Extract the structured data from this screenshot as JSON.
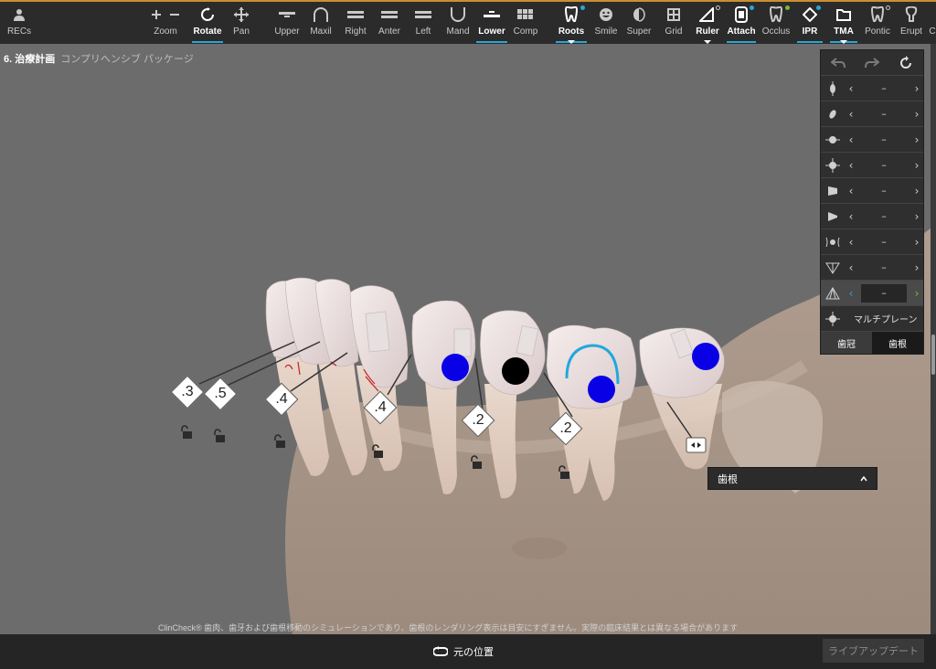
{
  "toolbar": {
    "recs_label": "RECs",
    "zoom_label": "Zoom",
    "rotate_label": "Rotate",
    "pan_label": "Pan",
    "upper_label": "Upper",
    "maxil_label": "Maxil",
    "right_label": "Right",
    "anter_label": "Anter",
    "left_label": "Left",
    "mand_label": "Mand",
    "lower_label": "Lower",
    "comp_label": "Comp",
    "roots_label": "Roots",
    "smile_label": "Smile",
    "super_label": "Super",
    "grid_label": "Grid",
    "ruler_label": "Ruler",
    "attach_label": "Attach",
    "occlus_label": "Occlus",
    "ipr_label": "IPR",
    "tma_label": "TMA",
    "pontic_label": "Pontic",
    "erupt_label": "Erupt",
    "overflow_label": "C"
  },
  "colors": {
    "accent": "#2aa6d6",
    "active_dot_blue": "#2aa6d6",
    "dot_green": "#7ab83a",
    "top_border": "#c8902e",
    "attachment_blue": "#0a00e6"
  },
  "header": {
    "step": "6. 治療計画",
    "subtitle": "コンプリヘンシブ パッケージ"
  },
  "panel": {
    "rows": [
      {
        "value": "–"
      },
      {
        "value": "–"
      },
      {
        "value": "–"
      },
      {
        "value": "–"
      },
      {
        "value": "–"
      },
      {
        "value": "–"
      },
      {
        "value": "–"
      },
      {
        "value": "–"
      },
      {
        "value": "–"
      }
    ],
    "multiplane_label": "マルチプレーン",
    "tab_crown": "歯冠",
    "tab_root": "歯根"
  },
  "ipr_values": [
    ".3",
    ".5",
    ".4",
    ".4",
    ".2",
    ".2"
  ],
  "dropdown": {
    "label": "歯根"
  },
  "disclaimer": "ClinCheck® 歯肉、歯牙および歯根移動のシミュレーションであり、歯根のレンダリング表示は目安にすぎません。実際の臨床結果とは異なる場合があります",
  "bottom": {
    "reset_label": "元の位置",
    "live_update_label": "ライブアップデート"
  }
}
